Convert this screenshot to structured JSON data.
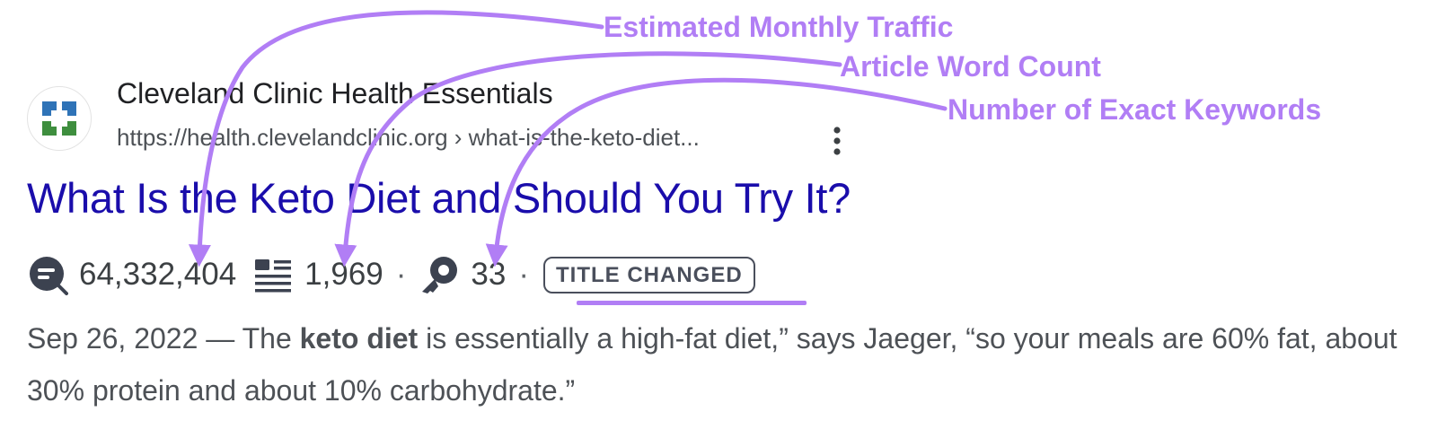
{
  "result": {
    "site_name": "Cleveland Clinic Health Essentials",
    "url": "https://health.clevelandclinic.org › what-is-the-keto-diet...",
    "favicon_icon": "cleveland-clinic-logo-icon",
    "more_icon": "more-vert-icon",
    "title": "What Is the Keto Diet and Should You Try It?",
    "metrics": {
      "traffic": {
        "icon": "traffic-chat-search-icon",
        "value": "64,332,404"
      },
      "word_count": {
        "icon": "article-list-icon",
        "value": "1,969"
      },
      "keywords": {
        "icon": "key-icon",
        "value": "33"
      },
      "separator": "·",
      "badge": "TITLE CHANGED"
    },
    "snippet": {
      "date": "Sep 26, 2022",
      "dash": " — ",
      "pre": "The ",
      "bold": "keto diet",
      "post": " is essentially a high-fat diet,” says Jaeger, “so your meals are 60% fat, about 30% protein and about 10% carbohydrate.”"
    }
  },
  "annotations": {
    "traffic": "Estimated Monthly Traffic",
    "word_count": "Article Word Count",
    "keywords": "Number of Exact Keywords"
  },
  "colors": {
    "annotation": "#b17ef5",
    "title_link": "#1a0dab",
    "text": "#4d5156",
    "logo_blue": "#2f73b7",
    "logo_green": "#3e8e3e"
  }
}
